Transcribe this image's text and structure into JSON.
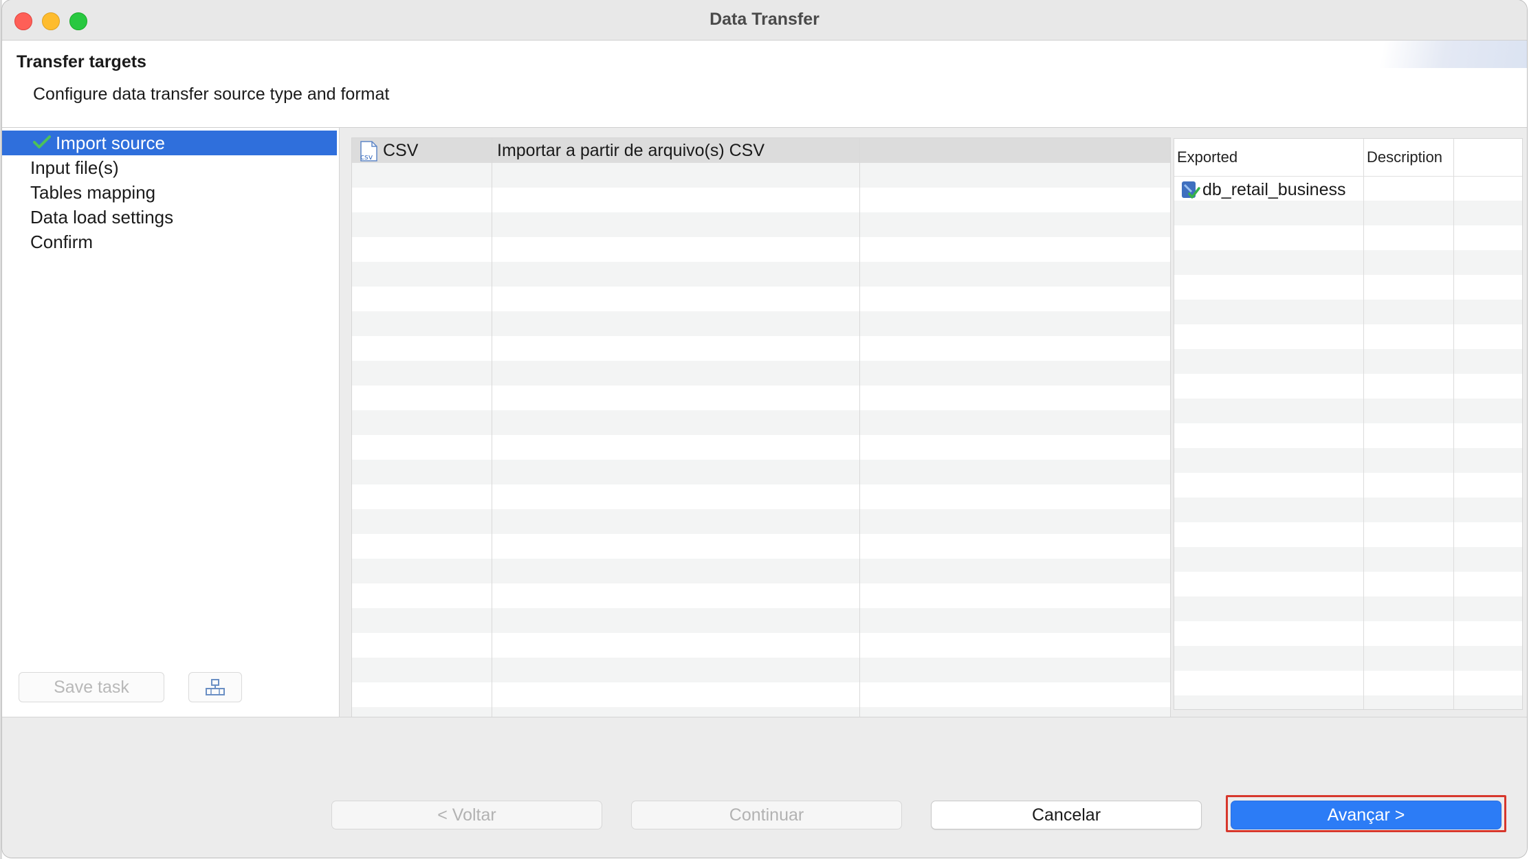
{
  "window": {
    "title": "Data Transfer"
  },
  "header": {
    "title": "Transfer targets",
    "subtitle": "Configure data transfer source type and format"
  },
  "sidebar": {
    "items": [
      {
        "label": "Import source",
        "selected": true,
        "icon": "checkmark-icon"
      },
      {
        "label": "Input file(s)"
      },
      {
        "label": "Tables mapping"
      },
      {
        "label": "Data load settings"
      },
      {
        "label": "Confirm"
      }
    ],
    "save_task_label": "Save task",
    "task_icon": "task-config-icon"
  },
  "source_table": {
    "rows": [
      {
        "icon": "csv-file-icon",
        "name": "CSV",
        "description": "Importar a partir de arquivo(s) CSV"
      }
    ]
  },
  "target_table": {
    "columns": [
      "Exported",
      "Description"
    ],
    "rows": [
      {
        "icon": "database-icon",
        "name": "db_retail_business",
        "description": ""
      }
    ]
  },
  "footer": {
    "back_label": "< Voltar",
    "continue_label": "Continuar",
    "cancel_label": "Cancelar",
    "next_label": "Avançar >"
  },
  "colors": {
    "selection": "#2f6fdc",
    "primary_button": "#2c7cf6",
    "highlight_border": "#d7372c"
  }
}
